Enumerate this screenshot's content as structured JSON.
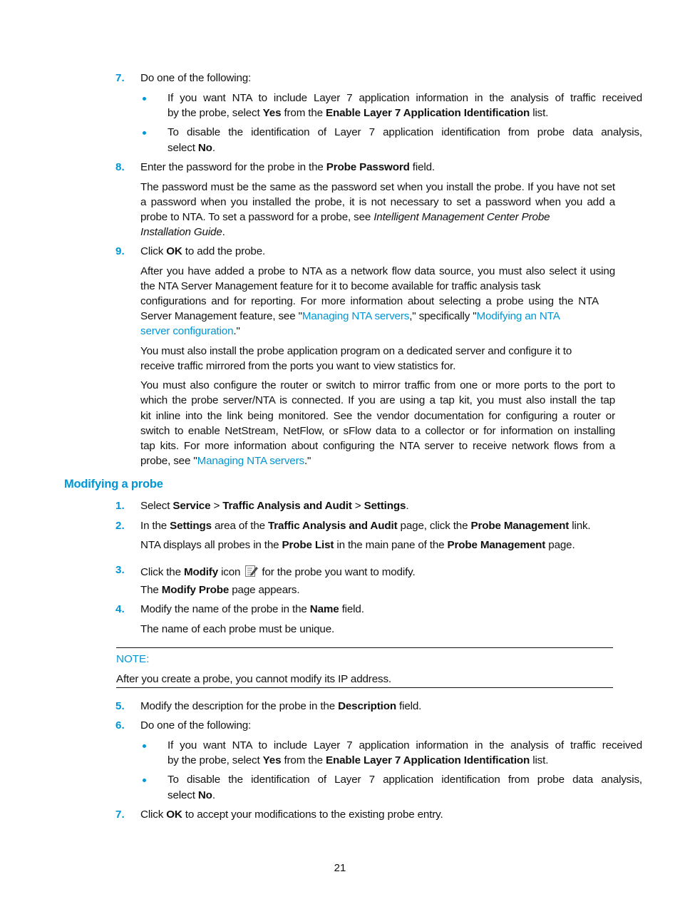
{
  "steps_a": {
    "s7": {
      "num": "7.",
      "text": "Do one of the following:"
    },
    "s7_b1": {
      "l1": "If you want NTA to include Layer 7 application information in the analysis of traffic received",
      "l2_pre": "by the probe, select ",
      "l2_b1": "Yes",
      "l2_mid": " from the ",
      "l2_b2": "Enable Layer 7 Application Identification",
      "l2_post": " list."
    },
    "s7_b2": {
      "l1": "To disable the identification of Layer 7 application identification from probe data analysis,",
      "l2_pre": "select ",
      "l2_b": "No",
      "l2_post": "."
    },
    "s8": {
      "num": "8.",
      "pre": "Enter the password for the probe in the ",
      "b": "Probe Password",
      "post": " field."
    },
    "s8_para": {
      "l1": "The password must be the same as the password set when you install the probe. If you have not set",
      "l2": "a password when you installed the probe, it is not necessary to set a password when you add a",
      "l3_pre": "probe to NTA. To set a password for a probe, see ",
      "l3_i": "Intelligent Management Center Probe",
      "l4_i": "Installation Guide",
      "l4_post": "."
    },
    "s9": {
      "num": "9.",
      "pre": "Click ",
      "b": "OK",
      "post": " to add the probe."
    },
    "s9_para1": {
      "l1": "After you have added a probe to NTA as a network flow data source, you must also select it using",
      "l2": "the NTA Server Management feature for it to become available for traffic analysis task",
      "l3": "configurations and for reporting. For more information about selecting a probe using the NTA",
      "l4_pre": "Server Management feature, see \"",
      "l4_link1": "Managing NTA servers",
      "l4_mid": ",\" specifically \"",
      "l4_link2": "Modifying an NTA",
      "l5_link": "server configuration",
      "l5_post": ".\""
    },
    "s9_para2": {
      "l1": "You must also install the probe application program on a dedicated server and configure it to",
      "l2": "receive traffic mirrored from the ports you want to view statistics for."
    },
    "s9_para3": {
      "l1": "You must also configure the router or switch to mirror traffic from one or more ports to the port to",
      "l2": "which the probe server/NTA is connected. If you are using a tap kit, you must also install the tap",
      "l3": "kit inline into the link being monitored. See the vendor documentation for configuring a router or",
      "l4": "switch to enable NetStream, NetFlow, or sFlow data to a collector or for information on installing",
      "l5": "tap kits. For more information about configuring the NTA server to receive network flows from a",
      "l6_pre": "probe, see \"",
      "l6_link": "Managing NTA servers",
      "l6_post": ".\""
    }
  },
  "section": {
    "title": "Modifying a probe",
    "s1": {
      "num": "1.",
      "pre": "Select ",
      "b1": "Service",
      "sep1": " > ",
      "b2": "Traffic Analysis and Audit",
      "sep2": " > ",
      "b3": "Settings",
      "post": "."
    },
    "s2": {
      "num": "2.",
      "pre": "In the ",
      "b1": "Settings",
      "mid1": " area of the ",
      "b2": "Traffic Analysis and Audit",
      "mid2": " page, click the ",
      "b3": "Probe Management",
      "post": " link."
    },
    "s2_para": {
      "pre": "NTA displays all probes in the ",
      "b1": "Probe List",
      "mid": " in the main pane of the ",
      "b2": "Probe Management",
      "post": " page."
    },
    "s3": {
      "num": "3.",
      "pre": "Click the ",
      "b": "Modify",
      "mid": " icon",
      "post": "for the probe you want to modify."
    },
    "s3_para": {
      "pre": "The ",
      "b": "Modify Probe",
      "post": " page appears."
    },
    "s4": {
      "num": "4.",
      "pre": "Modify the name of the probe in the ",
      "b": "Name",
      "post": " field."
    },
    "s4_para": "The name of each probe must be unique.",
    "note": {
      "label": "NOTE:",
      "text": "After you create a probe, you cannot modify its IP address."
    },
    "s5": {
      "num": "5.",
      "pre": "Modify the description for the probe in the ",
      "b": "Description",
      "post": " field."
    },
    "s6": {
      "num": "6.",
      "text": "Do one of the following:"
    },
    "s6_b1": {
      "l1": "If you want NTA to include Layer 7 application information in the analysis of traffic received",
      "l2_pre": "by the probe, select ",
      "l2_b1": "Yes",
      "l2_mid": " from the ",
      "l2_b2": "Enable Layer 7 Application Identification",
      "l2_post": " list."
    },
    "s6_b2": {
      "l1": "To disable the identification of Layer 7 application identification from probe data analysis,",
      "l2_pre": "select ",
      "l2_b": "No",
      "l2_post": "."
    },
    "s7": {
      "num": "7.",
      "pre": "Click ",
      "b": "OK",
      "post": " to accept your modifications to the existing probe entry."
    }
  },
  "footer": {
    "page_number": "21"
  },
  "colors": {
    "accent": "#0096d6",
    "text": "#111111"
  }
}
